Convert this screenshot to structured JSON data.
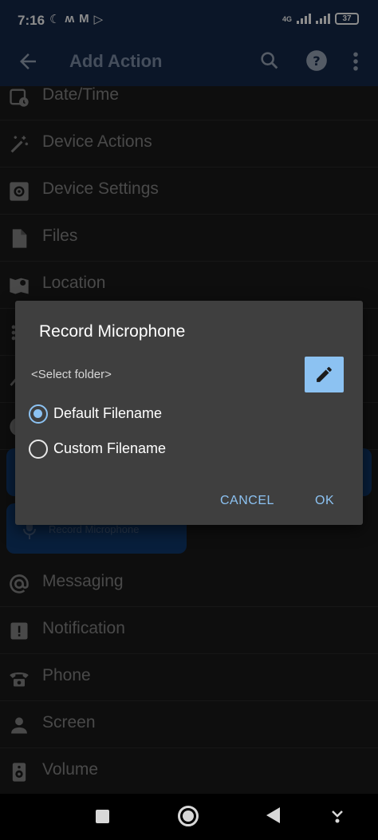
{
  "status": {
    "time": "7:16",
    "network": "4G",
    "battery": "37"
  },
  "appbar": {
    "title": "Add Action"
  },
  "categories": [
    {
      "label": "Date/Time",
      "icon": "calendar-clock-icon"
    },
    {
      "label": "Device Actions",
      "icon": "magic-wand-icon"
    },
    {
      "label": "Device Settings",
      "icon": "settings-box-icon"
    },
    {
      "label": "Files",
      "icon": "file-icon"
    },
    {
      "label": "Location",
      "icon": "map-pin-icon"
    },
    {
      "label": "Messaging",
      "icon": "at-sign-icon"
    },
    {
      "label": "Notification",
      "icon": "alert-box-icon"
    },
    {
      "label": "Phone",
      "icon": "phone-icon"
    },
    {
      "label": "Screen",
      "icon": "person-icon"
    },
    {
      "label": "Volume",
      "icon": "speaker-icon"
    }
  ],
  "highlighted_action": {
    "label": "Record Microphone",
    "icon": "microphone-icon"
  },
  "dialog": {
    "title": "Record Microphone",
    "folder_placeholder": "<Select folder>",
    "options": [
      {
        "label": "Default Filename",
        "selected": true
      },
      {
        "label": "Custom Filename",
        "selected": false
      }
    ],
    "cancel_label": "CANCEL",
    "ok_label": "OK"
  },
  "colors": {
    "header_bg": "#15294a",
    "accent": "#8cc2f2",
    "dialog_bg": "#3f3f3f"
  }
}
